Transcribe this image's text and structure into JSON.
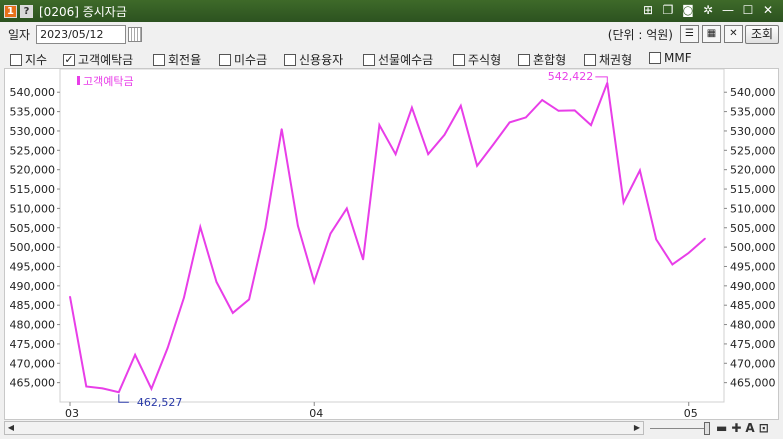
{
  "window": {
    "badge1": "1",
    "badge2": "?",
    "title": "[0206] 증시자금",
    "icons": [
      "pin-icon",
      "copy-icon",
      "camera-icon",
      "gear-icon",
      "minimize-icon",
      "maximize-icon",
      "close-icon"
    ]
  },
  "toolbar": {
    "date_label": "일자",
    "date_value": "2023/05/12",
    "unit_label": "(단위 : 억원)",
    "lookup_label": "조회"
  },
  "checkboxes": [
    {
      "label": "지수",
      "checked": false
    },
    {
      "label": "고객예탁금",
      "checked": true
    },
    {
      "label": "회전율",
      "checked": false
    },
    {
      "label": "미수금",
      "checked": false
    },
    {
      "label": "신용융자",
      "checked": false
    },
    {
      "label": "선물예수금",
      "checked": false
    },
    {
      "label": "주식형",
      "checked": false
    },
    {
      "label": "혼합형",
      "checked": false
    },
    {
      "label": "채권형",
      "checked": false
    },
    {
      "label": "MMF",
      "checked": false
    }
  ],
  "chart_data": {
    "type": "line",
    "legend": "고객예탁금",
    "series_color": "#e83ee8",
    "ylim": [
      460000,
      546000
    ],
    "y_ticks": [
      465000,
      470000,
      475000,
      480000,
      485000,
      490000,
      495000,
      500000,
      505000,
      510000,
      515000,
      520000,
      525000,
      530000,
      535000,
      540000
    ],
    "y_tick_labels": [
      "465,000",
      "470,000",
      "475,000",
      "480,000",
      "485,000",
      "490,000",
      "495,000",
      "500,000",
      "505,000",
      "510,000",
      "515,000",
      "520,000",
      "525,000",
      "530,000",
      "535,000",
      "540,000"
    ],
    "x_tick_labels": [
      {
        "label": "03",
        "index": 0
      },
      {
        "label": "04",
        "index": 15
      },
      {
        "label": "05",
        "index": 38
      }
    ],
    "values": [
      487200,
      464000,
      463500,
      462527,
      472200,
      463400,
      474000,
      487000,
      505200,
      491000,
      483000,
      486500,
      505000,
      530500,
      505500,
      491000,
      503500,
      510000,
      496800,
      531500,
      524000,
      536000,
      524000,
      529000,
      536500,
      521000,
      526500,
      532200,
      533500,
      538000,
      535200,
      535300,
      531500,
      542422,
      511500,
      519800,
      502000,
      495500,
      498500,
      502200
    ],
    "annotations": [
      {
        "label": "462,527",
        "index": 3,
        "kind": "min",
        "color": "#2a3aa8"
      },
      {
        "label": "542,422",
        "index": 33,
        "kind": "max",
        "color": "#e83ee8"
      }
    ]
  }
}
